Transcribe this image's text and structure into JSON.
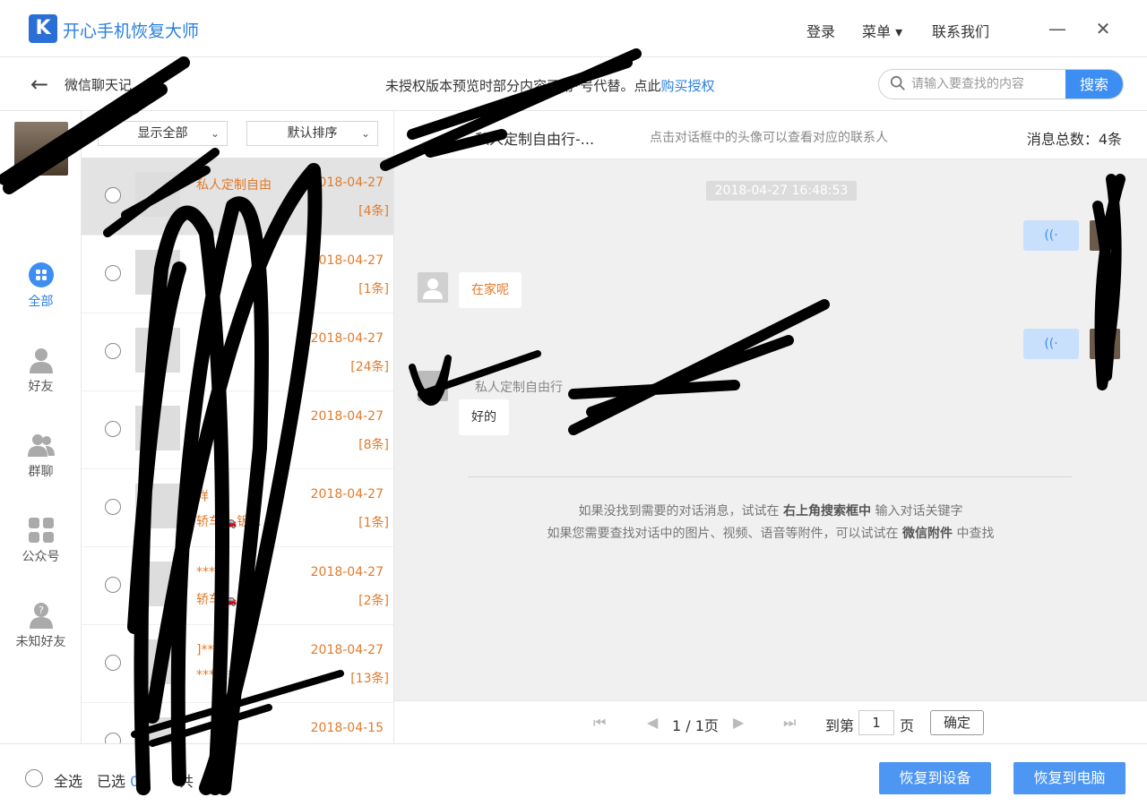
{
  "app": {
    "logo_letter": "K",
    "title": "开心手机恢复大师",
    "links": {
      "login": "登录",
      "menu": "菜单 ▾",
      "contact": "联系我们"
    },
    "minimize": "—",
    "close": "✕"
  },
  "subbar": {
    "breadcrumb": "微信聊天记",
    "notice_prefix": "未授权版本预览时部分内容已用*号代替。点此",
    "notice_link": "购买授权",
    "search_placeholder": "请输入要查找的内容",
    "search_button": "搜索"
  },
  "leftnav": {
    "items": [
      {
        "label": "全部",
        "icon": "grid-dots-icon",
        "active": true
      },
      {
        "label": "好友",
        "icon": "person-icon",
        "active": false
      },
      {
        "label": "群聊",
        "icon": "group-icon",
        "active": false
      },
      {
        "label": "公众号",
        "icon": "apps-icon",
        "active": false
      },
      {
        "label": "未知好友",
        "icon": "unknown-person-icon",
        "active": false
      }
    ]
  },
  "convlist": {
    "filter_show": "显示全部",
    "filter_sort": "默认排序",
    "items": [
      {
        "name": "私人定制自由",
        "preview": "",
        "date": "2018-04-27",
        "count": "[4条]",
        "selected": true
      },
      {
        "name": "",
        "preview": "",
        "date": "2018-04-27",
        "count": "[1条]",
        "selected": false
      },
      {
        "name": "",
        "preview": "",
        "date": "2018-04-27",
        "count": "[24条]",
        "selected": false
      },
      {
        "name": "",
        "preview": "",
        "date": "2018-04-27",
        "count": "[8条]",
        "selected": false
      },
      {
        "name": "祥",
        "preview": "轿车🚗钣...",
        "date": "2018-04-27",
        "count": "[1条]",
        "selected": false
      },
      {
        "name": "***",
        "preview": "轿车🚗钣...",
        "date": "2018-04-27",
        "count": "[2条]",
        "selected": false
      },
      {
        "name": "]****",
        "preview": "*******",
        "date": "2018-04-27",
        "count": "[13条]",
        "selected": false
      },
      {
        "name": "",
        "preview": "",
        "date": "2018-04-15",
        "count": "",
        "selected": false
      }
    ]
  },
  "chat": {
    "title": "私人定制自由行-...",
    "hint": "点击对话框中的头像可以查看对应的联系人",
    "total_label": "消息总数：4条",
    "timestamp": "2018-04-27 16:48:53",
    "messages": [
      {
        "text": "在家呢"
      },
      {
        "sender": "私人定制自由行"
      },
      {
        "text": "好的"
      }
    ],
    "voice_glyph": "((·",
    "tip_line1_a": "如果没找到需要的对话消息，试试在 ",
    "tip_line1_b": "右上角搜索框中",
    "tip_line1_c": " 输入对话关键字",
    "tip_line2_a": "如果您需要查找对话中的图片、视频、语音等附件，可以试试在 ",
    "tip_line2_b": "微信附件",
    "tip_line2_c": " 中查找"
  },
  "pager": {
    "first": "⏮",
    "prev": "◀",
    "page_info": "1 / 1页",
    "next": "▶",
    "last": "⏭",
    "goto_label": "到第",
    "goto_value": "1",
    "page_unit": "页",
    "confirm": "确定"
  },
  "bottom": {
    "select_all": "全选",
    "selected_label": "已选",
    "selected_count": "0",
    "total_prefix": "共",
    "total_suffix": "条",
    "restore_device": "恢复到设备",
    "restore_pc": "恢复到电脑"
  }
}
